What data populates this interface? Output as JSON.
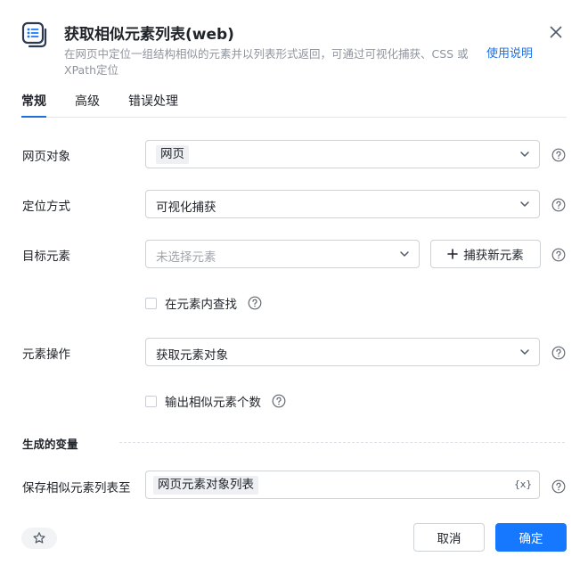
{
  "header": {
    "title": "获取相似元素列表(web)",
    "description": "在网页中定位一组结构相似的元素并以列表形式返回，可通过可视化捕获、CSS 或 XPath定位",
    "help_link": "使用说明"
  },
  "tabs": [
    {
      "label": "常规",
      "active": true
    },
    {
      "label": "高级",
      "active": false
    },
    {
      "label": "错误处理",
      "active": false
    }
  ],
  "fields": {
    "web_object": {
      "label": "网页对象",
      "value": "网页"
    },
    "locate_method": {
      "label": "定位方式",
      "value": "可视化捕获"
    },
    "target_element": {
      "label": "目标元素",
      "placeholder": "未选择元素",
      "capture_button": "捕获新元素"
    },
    "search_within": {
      "label": "在元素内查找",
      "checked": false
    },
    "element_action": {
      "label": "元素操作",
      "value": "获取元素对象"
    },
    "output_count": {
      "label": "输出相似元素个数",
      "checked": false
    }
  },
  "generated_vars": {
    "section_title": "生成的变量",
    "save_to": {
      "label": "保存相似元素列表至",
      "value": "网页元素对象列表",
      "fx": "{x}"
    }
  },
  "footer": {
    "cancel": "取消",
    "confirm": "确定"
  },
  "colors": {
    "primary": "#1677ff",
    "link": "#1d6fe0",
    "border": "#d0d3d6"
  }
}
